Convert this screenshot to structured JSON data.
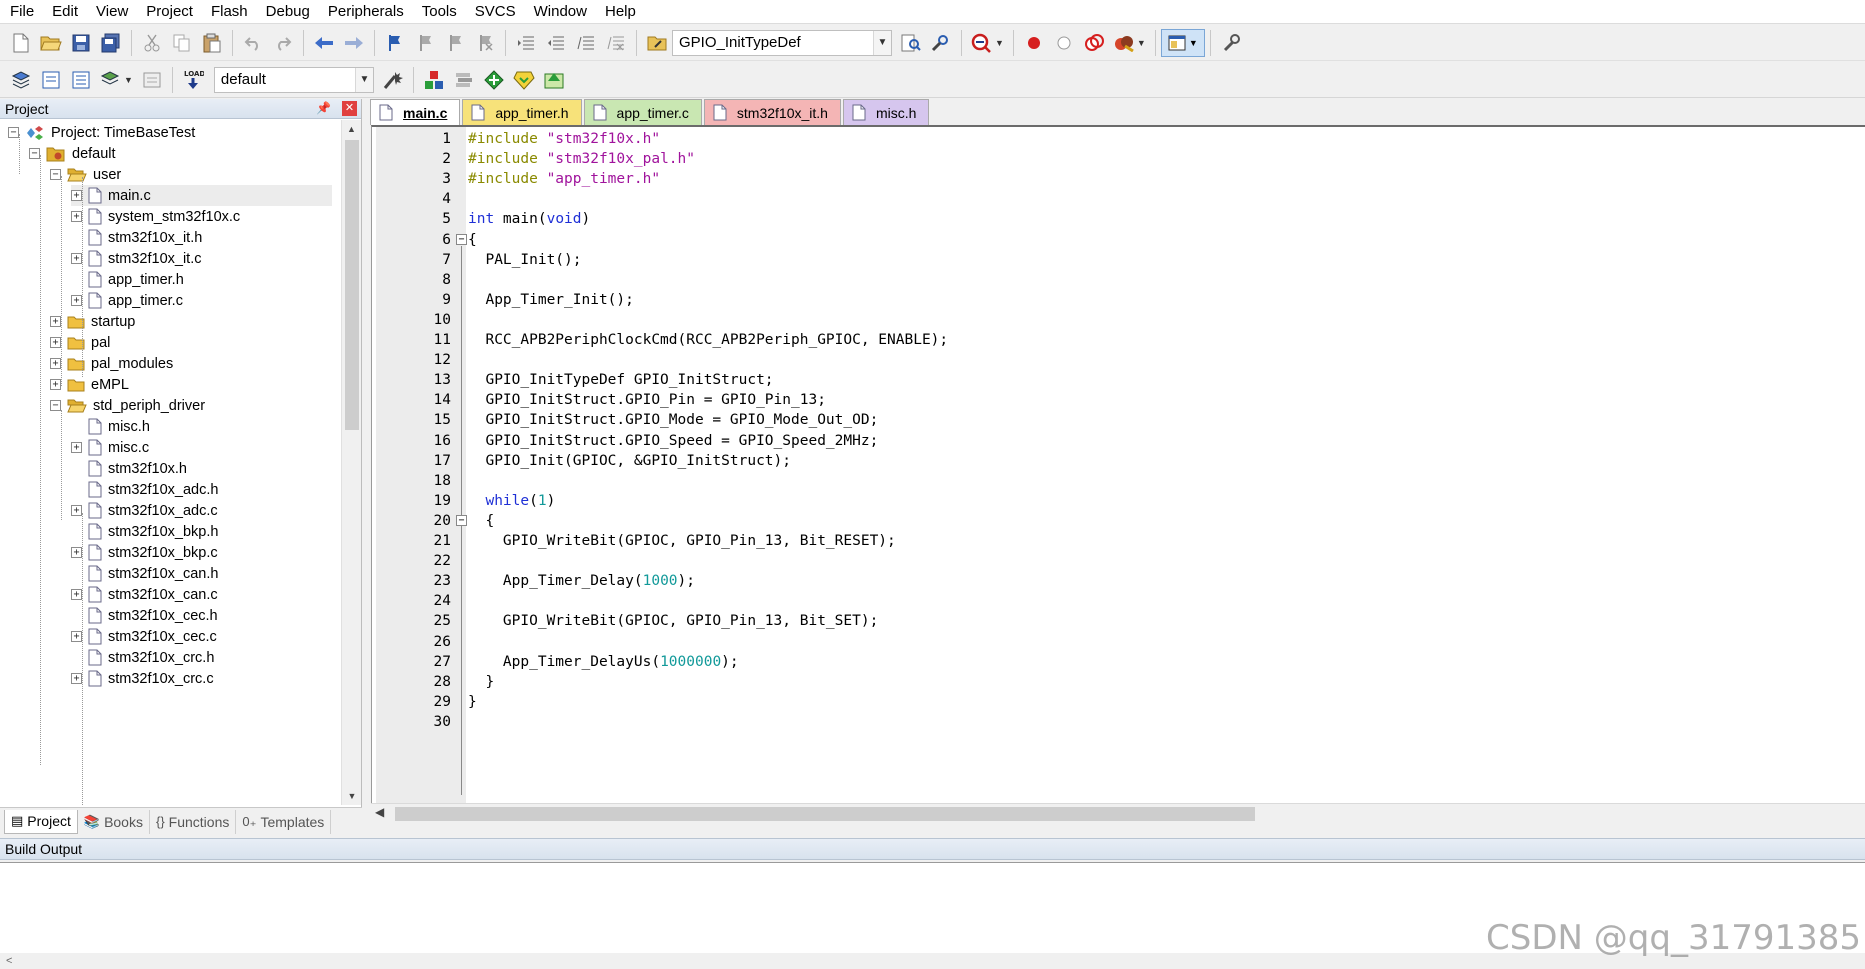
{
  "menu": [
    "File",
    "Edit",
    "View",
    "Project",
    "Flash",
    "Debug",
    "Peripherals",
    "Tools",
    "SVCS",
    "Window",
    "Help"
  ],
  "toolbar1": {
    "find_combo_value": "GPIO_InitTypeDef"
  },
  "toolbar2": {
    "target_combo_value": "default",
    "load_label": "LOAD"
  },
  "project_panel": {
    "title": "Project",
    "tree": [
      {
        "label": "Project: TimeBaseTest",
        "icon": "project-icon",
        "expander": "-"
      },
      {
        "label": "default",
        "icon": "target-icon",
        "expander": "-"
      },
      {
        "label": "user",
        "icon": "folder-open-icon",
        "expander": "-"
      },
      {
        "label": "main.c",
        "icon": "file-icon",
        "expander": "+"
      },
      {
        "label": "system_stm32f10x.c",
        "icon": "file-icon",
        "expander": "+"
      },
      {
        "label": "stm32f10x_it.h",
        "icon": "file-icon",
        "expander": ""
      },
      {
        "label": "stm32f10x_it.c",
        "icon": "file-icon",
        "expander": "+"
      },
      {
        "label": "app_timer.h",
        "icon": "file-icon",
        "expander": ""
      },
      {
        "label": "app_timer.c",
        "icon": "file-icon",
        "expander": "+"
      },
      {
        "label": "startup",
        "icon": "folder-icon",
        "expander": "+"
      },
      {
        "label": "pal",
        "icon": "folder-icon",
        "expander": "+"
      },
      {
        "label": "pal_modules",
        "icon": "folder-icon",
        "expander": "+"
      },
      {
        "label": "eMPL",
        "icon": "folder-icon",
        "expander": "+"
      },
      {
        "label": "std_periph_driver",
        "icon": "folder-open-icon",
        "expander": "-"
      },
      {
        "label": "misc.h",
        "icon": "file-icon",
        "expander": ""
      },
      {
        "label": "misc.c",
        "icon": "file-icon",
        "expander": "+"
      },
      {
        "label": "stm32f10x.h",
        "icon": "file-icon",
        "expander": ""
      },
      {
        "label": "stm32f10x_adc.h",
        "icon": "file-icon",
        "expander": ""
      },
      {
        "label": "stm32f10x_adc.c",
        "icon": "file-icon",
        "expander": "+"
      },
      {
        "label": "stm32f10x_bkp.h",
        "icon": "file-icon",
        "expander": ""
      },
      {
        "label": "stm32f10x_bkp.c",
        "icon": "file-icon",
        "expander": "+"
      },
      {
        "label": "stm32f10x_can.h",
        "icon": "file-icon",
        "expander": ""
      },
      {
        "label": "stm32f10x_can.c",
        "icon": "file-icon",
        "expander": "+"
      },
      {
        "label": "stm32f10x_cec.h",
        "icon": "file-icon",
        "expander": ""
      },
      {
        "label": "stm32f10x_cec.c",
        "icon": "file-icon",
        "expander": "+"
      },
      {
        "label": "stm32f10x_crc.h",
        "icon": "file-icon",
        "expander": ""
      },
      {
        "label": "stm32f10x_crc.c",
        "icon": "file-icon",
        "expander": "+"
      }
    ],
    "tabs": [
      {
        "label": "Project",
        "icon": "project-icon"
      },
      {
        "label": "Books",
        "icon": "books-icon"
      },
      {
        "label": "Functions",
        "icon": "functions-icon"
      },
      {
        "label": "Templates",
        "icon": "templates-icon"
      }
    ]
  },
  "editor_tabs": [
    {
      "label": "main.c",
      "color": "#ffffff"
    },
    {
      "label": "app_timer.h",
      "color": "#f7e27a"
    },
    {
      "label": "app_timer.c",
      "color": "#c9e7b2"
    },
    {
      "label": "stm32f10x_it.h",
      "color": "#f4b5b5"
    },
    {
      "label": "misc.h",
      "color": "#d6c6ee"
    }
  ],
  "code_lines": [
    "#include \"stm32f10x.h\"",
    "#include \"stm32f10x_pal.h\"",
    "#include \"app_timer.h\"",
    "",
    "int main(void)",
    "{",
    "  PAL_Init();",
    "",
    "  App_Timer_Init();",
    "",
    "  RCC_APB2PeriphClockCmd(RCC_APB2Periph_GPIOC, ENABLE);",
    "",
    "  GPIO_InitTypeDef GPIO_InitStruct;",
    "  GPIO_InitStruct.GPIO_Pin = GPIO_Pin_13;",
    "  GPIO_InitStruct.GPIO_Mode = GPIO_Mode_Out_OD;",
    "  GPIO_InitStruct.GPIO_Speed = GPIO_Speed_2MHz;",
    "  GPIO_Init(GPIOC, &GPIO_InitStruct);",
    "",
    "  while(1)",
    "  {",
    "    GPIO_WriteBit(GPIOC, GPIO_Pin_13, Bit_RESET);",
    "",
    "    App_Timer_Delay(1000);",
    "",
    "    GPIO_WriteBit(GPIOC, GPIO_Pin_13, Bit_SET);",
    "",
    "    App_Timer_DelayUs(1000000);",
    "  }",
    "}",
    ""
  ],
  "build_output": {
    "title": "Build Output",
    "text": ""
  },
  "watermark": "CSDN @qq_31791385"
}
